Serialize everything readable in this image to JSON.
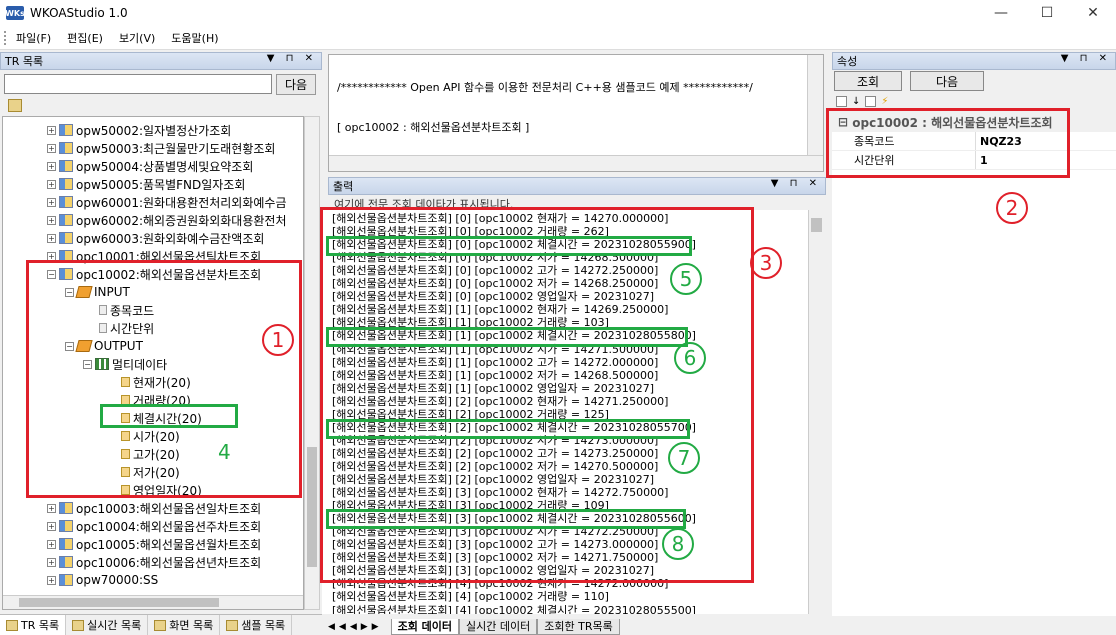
{
  "window": {
    "title": "WKOAStudio 1.0",
    "icon_text": "WKs",
    "minimize": "—",
    "maximize": "☐",
    "close": "✕"
  },
  "menu": [
    "파일(F)",
    "편집(E)",
    "보기(V)",
    "도움말(H)"
  ],
  "tr_panel": {
    "title": "TR 목록",
    "next_label": "다음"
  },
  "tree": {
    "items": [
      {
        "label": "opw50002:일자별정산가조회"
      },
      {
        "label": "opw50003:최근월물만기도래현황조회"
      },
      {
        "label": "opw50004:상품별명세및요약조회"
      },
      {
        "label": "opw50005:품목별FND일자조회"
      },
      {
        "label": "opw60001:원화대용환전처리외화예수금"
      },
      {
        "label": "opw60002:해외증권원화외화대용환전처"
      },
      {
        "label": "opw60003:원화외화예수금잔액조회"
      },
      {
        "label": "opc10001:해외선물옵션틱차트조회"
      },
      {
        "label": "opc10002:해외선물옵션분차트조회"
      },
      {
        "label": "INPUT"
      },
      {
        "label": "종목코드"
      },
      {
        "label": "시간단위"
      },
      {
        "label": "OUTPUT"
      },
      {
        "label": "멀티데이타"
      },
      {
        "label": "현재가(20)"
      },
      {
        "label": "거래량(20)"
      },
      {
        "label": "체결시간(20)"
      },
      {
        "label": "시가(20)"
      },
      {
        "label": "고가(20)"
      },
      {
        "label": "저가(20)"
      },
      {
        "label": "영업일자(20)"
      },
      {
        "label": "opc10003:해외선물옵션일차트조회"
      },
      {
        "label": "opc10004:해외선물옵션주차트조회"
      },
      {
        "label": "opc10005:해외선물옵션월차트조회"
      },
      {
        "label": "opc10006:해외선물옵션년차트조회"
      },
      {
        "label": "opw70000:SS"
      }
    ]
  },
  "left_tabs": [
    "TR 목록",
    "실시간 목록",
    "화면 목록",
    "샘플 목록"
  ],
  "code_panel": {
    "line1": "/************ Open API 함수를 이용한 전문처리 C++용 샘플코드 예제 ************/",
    "line2": "[ opc10002 : 해외선물옵션분차트조회 ]"
  },
  "output_panel": {
    "title": "출력",
    "hint": "여기에 전문 조회 데이타가 표시됩니다.",
    "lines": [
      "[해외선물옵션분차트조회] [0] [opc10002 현재가 = 14270.000000]",
      "[해외선물옵션분차트조회] [0] [opc10002 거래량 = 262]",
      "[해외선물옵션분차트조회] [0] [opc10002 체결시간 = 20231028055900]",
      "[해외선물옵션분차트조회] [0] [opc10002 시가 = 14268.500000]",
      "[해외선물옵션분차트조회] [0] [opc10002 고가 = 14272.250000]",
      "[해외선물옵션분차트조회] [0] [opc10002 저가 = 14268.250000]",
      "[해외선물옵션분차트조회] [0] [opc10002 영업일자 = 20231027]",
      "[해외선물옵션분차트조회] [1] [opc10002 현재가 = 14269.250000]",
      "[해외선물옵션분차트조회] [1] [opc10002 거래량 = 103]",
      "[해외선물옵션분차트조회] [1] [opc10002 체결시간 = 20231028055800]",
      "[해외선물옵션분차트조회] [1] [opc10002 시가 = 14271.500000]",
      "[해외선물옵션분차트조회] [1] [opc10002 고가 = 14272.000000]",
      "[해외선물옵션분차트조회] [1] [opc10002 저가 = 14268.500000]",
      "[해외선물옵션분차트조회] [1] [opc10002 영업일자 = 20231027]",
      "[해외선물옵션분차트조회] [2] [opc10002 현재가 = 14271.250000]",
      "[해외선물옵션분차트조회] [2] [opc10002 거래량 = 125]",
      "[해외선물옵션분차트조회] [2] [opc10002 체결시간 = 20231028055700]",
      "[해외선물옵션분차트조회] [2] [opc10002 시가 = 14273.000000]",
      "[해외선물옵션분차트조회] [2] [opc10002 고가 = 14273.250000]",
      "[해외선물옵션분차트조회] [2] [opc10002 저가 = 14270.500000]",
      "[해외선물옵션분차트조회] [2] [opc10002 영업일자 = 20231027]",
      "[해외선물옵션분차트조회] [3] [opc10002 현재가 = 14272.750000]",
      "[해외선물옵션분차트조회] [3] [opc10002 거래량 = 109]",
      "[해외선물옵션분차트조회] [3] [opc10002 체결시간 = 20231028055600]",
      "[해외선물옵션분차트조회] [3] [opc10002 시가 = 14272.250000]",
      "[해외선물옵션분차트조회] [3] [opc10002 고가 = 14273.000000]",
      "[해외선물옵션분차트조회] [3] [opc10002 저가 = 14271.750000]",
      "[해외선물옵션분차트조회] [3] [opc10002 영업일자 = 20231027]",
      "[해외선물옵션분차트조회] [4] [opc10002 현재가 = 14272.000000]",
      "[해외선물옵션분차트조회] [4] [opc10002 거래량 = 110]",
      "[해외선물옵션분차트조회] [4] [opc10002 체결시간 = 20231028055500]"
    ]
  },
  "output_tabs": [
    "조회 데이터",
    "실시간 데이터",
    "조회한 TR목록"
  ],
  "properties": {
    "title": "속성",
    "query_button": "조회",
    "next_button": "다음",
    "category": "opc10002 : 해외선물옵션분차트조회",
    "rows": [
      {
        "name": "종목코드",
        "value": "NQZ23"
      },
      {
        "name": "시간단위",
        "value": "1"
      }
    ]
  },
  "annotations": {
    "circles_red": [
      "1",
      "2",
      "3"
    ],
    "plain_green": "4",
    "circles_green": [
      "5",
      "6",
      "7",
      "8"
    ]
  },
  "colors": {
    "annotation_red": "#e0202a",
    "annotation_green": "#22aa44"
  }
}
